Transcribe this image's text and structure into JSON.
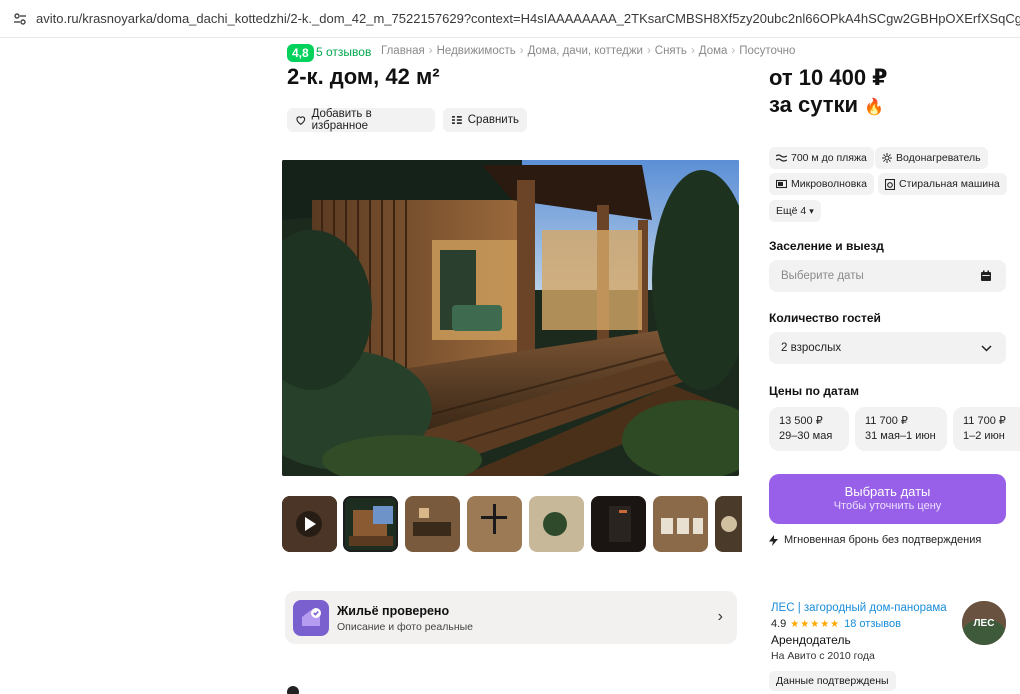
{
  "browser": {
    "url": "avito.ru/krasnoyarka/doma_dachi_kottedzhi/2-k._dom_42_m_7522157629?context=H4sIAAAAAAAA_2TKsarCMBSH8Xf5zy20ubc2nl66OPkA4hSCgw2GBHpOXErfXSqCg-vv-xz9"
  },
  "listing": {
    "rating": "4,8",
    "reviews": "5 отзывов",
    "breadcrumbs": [
      "Главная",
      "Недвижимость",
      "Дома, дачи, коттеджи",
      "Снять",
      "Дома",
      "Посуточно"
    ],
    "title": "2-к. дом, 42 м²",
    "favorite_label": "Добавить в избранное",
    "compare_label": "Сравнить",
    "thumbnails_count": 8
  },
  "verified": {
    "title": "Жильё проверено",
    "subtitle": "Описание и фото реальные"
  },
  "booking": {
    "price_line1": "от 10 400 ₽",
    "price_line2": "за сутки",
    "amenities": [
      "700 м до пляжа",
      "Водонагреватель",
      "Микроволновка",
      "Стиральная машина"
    ],
    "more_label": "Ещё 4",
    "checkin_label": "Заселение и выезд",
    "dates_placeholder": "Выберите даты",
    "guests_label": "Количество гостей",
    "guests_value": "2 взрослых",
    "prices_label": "Цены по датам",
    "date_prices": [
      {
        "price": "13 500 ₽",
        "dates": "29–30 мая"
      },
      {
        "price": "11 700 ₽",
        "dates": "31 мая–1 июн"
      },
      {
        "price": "11 700 ₽",
        "dates": "1–2 июн"
      }
    ],
    "book_button": "Выбрать даты",
    "book_sub": "Чтобы уточнить цену",
    "instant_note": "Мгновенная бронь без подтверждения"
  },
  "host": {
    "name": "ЛЕС | загородный дом-панорама",
    "rating": "4.9",
    "reviews": "18 отзывов",
    "role": "Арендодатель",
    "since": "На Авито с 2010 года",
    "verified_label": "Данные подтверждены",
    "avatar_text": "ЛЕС"
  },
  "colors": {
    "accent": "#9860e8",
    "rating_green": "#02d15c",
    "link_blue": "#1a8cd8"
  }
}
